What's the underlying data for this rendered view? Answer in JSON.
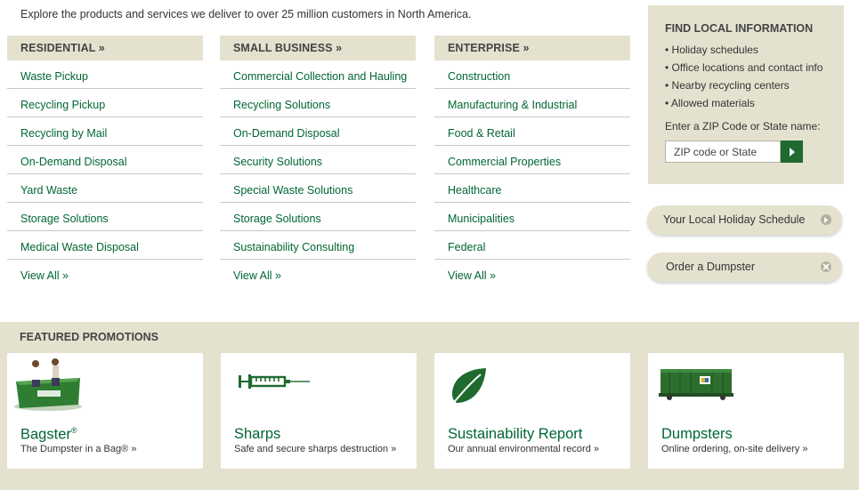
{
  "intro": "Explore the products and services we deliver to over 25 million customers in North America.",
  "residential": {
    "heading": "RESIDENTIAL »",
    "items": [
      "Waste Pickup",
      "Recycling Pickup",
      "Recycling by Mail",
      "On-Demand Disposal",
      "Yard Waste",
      "Storage Solutions",
      "Medical Waste Disposal"
    ],
    "view_all": "View All »"
  },
  "small_business": {
    "heading": "SMALL BUSINESS »",
    "items": [
      "Commercial Collection and Hauling",
      "Recycling Solutions",
      "On-Demand Disposal",
      "Security Solutions",
      "Special Waste Solutions",
      "Storage Solutions",
      "Sustainability Consulting"
    ],
    "view_all": "View All »"
  },
  "enterprise": {
    "heading": "ENTERPRISE »",
    "items": [
      "Construction",
      "Manufacturing & Industrial",
      "Food & Retail",
      "Commercial Properties",
      "Healthcare",
      "Municipalities",
      "Federal"
    ],
    "view_all": "View All »"
  },
  "local_info": {
    "title": "FIND LOCAL INFORMATION",
    "items": [
      "Holiday schedules",
      "Office locations and contact info",
      "Nearby recycling centers",
      "Allowed materials"
    ],
    "zip_label": "Enter a ZIP Code or State name:",
    "zip_placeholder": "ZIP code or State"
  },
  "buttons": {
    "holiday": "Your Local Holiday Schedule",
    "dumpster": "Order a Dumpster"
  },
  "promotions": {
    "title": "FEATURED PROMOTIONS",
    "cards": [
      {
        "name": "Bagster",
        "reg": "®",
        "sub": "The Dumpster in a Bag® »",
        "icon": "bagster-image"
      },
      {
        "name": "Sharps",
        "sub": "Safe and secure sharps destruction »",
        "icon": "syringe-icon"
      },
      {
        "name": "Sustainability Report",
        "sub": "Our annual environmental record »",
        "icon": "leaf-icon"
      },
      {
        "name": "Dumpsters",
        "sub": "Online ordering, on-site delivery »",
        "icon": "dumpster-image"
      }
    ]
  },
  "colors": {
    "accent_green": "#006633",
    "panel_beige": "#e4e2cf",
    "button_green": "#1e6a2f"
  }
}
